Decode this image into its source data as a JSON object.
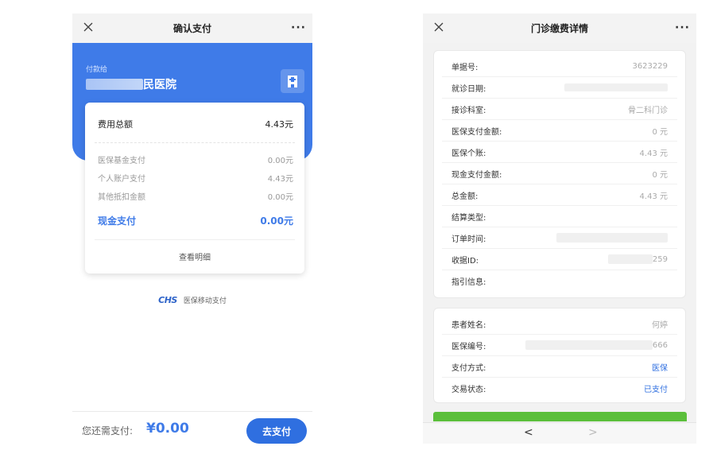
{
  "left": {
    "nav": {
      "title": "确认支付",
      "more": "···"
    },
    "pay_to_label": "付款给",
    "hospital_name_visible": "民医院",
    "card": {
      "total_label": "费用总额",
      "total_value": "4.43元",
      "items": [
        {
          "label": "医保基金支付",
          "value": "0.00元"
        },
        {
          "label": "个人账户支付",
          "value": "4.43元"
        },
        {
          "label": "其他抵扣金额",
          "value": "0.00元"
        }
      ],
      "cash_label": "现金支付",
      "cash_value": "0.00元",
      "detail_link": "查看明细"
    },
    "chs_logo": "CHS",
    "chs_text": "医保移动支付",
    "bottom": {
      "need_label": "您还需支付:",
      "need_amount": "¥0.00",
      "pay_button": "去支付"
    },
    "colors": {
      "primary": "#3f7be8",
      "button": "#2f6fe0"
    }
  },
  "right": {
    "nav": {
      "title": "门诊缴费详情",
      "more": "···"
    },
    "section1": [
      {
        "label": "单据号:",
        "value": "3623229"
      },
      {
        "label": "就诊日期:",
        "value": ""
      },
      {
        "label": "接诊科室:",
        "value": "骨二科门诊"
      },
      {
        "label": "医保支付金额:",
        "value": "0 元"
      },
      {
        "label": "医保个账:",
        "value": "4.43 元"
      },
      {
        "label": "现金支付金额:",
        "value": "0 元"
      },
      {
        "label": "总金额:",
        "value": "4.43 元"
      },
      {
        "label": "结算类型:",
        "value": ""
      },
      {
        "label": "订单时间:",
        "value": ""
      },
      {
        "label": "收据ID:",
        "value": "259"
      },
      {
        "label": "指引信息:",
        "value": ""
      }
    ],
    "section2": [
      {
        "label": "患者姓名:",
        "value": "何婷"
      },
      {
        "label": "医保编号:",
        "value": "666"
      },
      {
        "label": "支付方式:",
        "value": "医保"
      },
      {
        "label": "交易状态:",
        "value": "已支付"
      }
    ],
    "bottom_nav": {
      "back": "<",
      "forward": ">"
    },
    "colors": {
      "green": "#5bbf3b",
      "blue": "#2f6fe0"
    }
  }
}
